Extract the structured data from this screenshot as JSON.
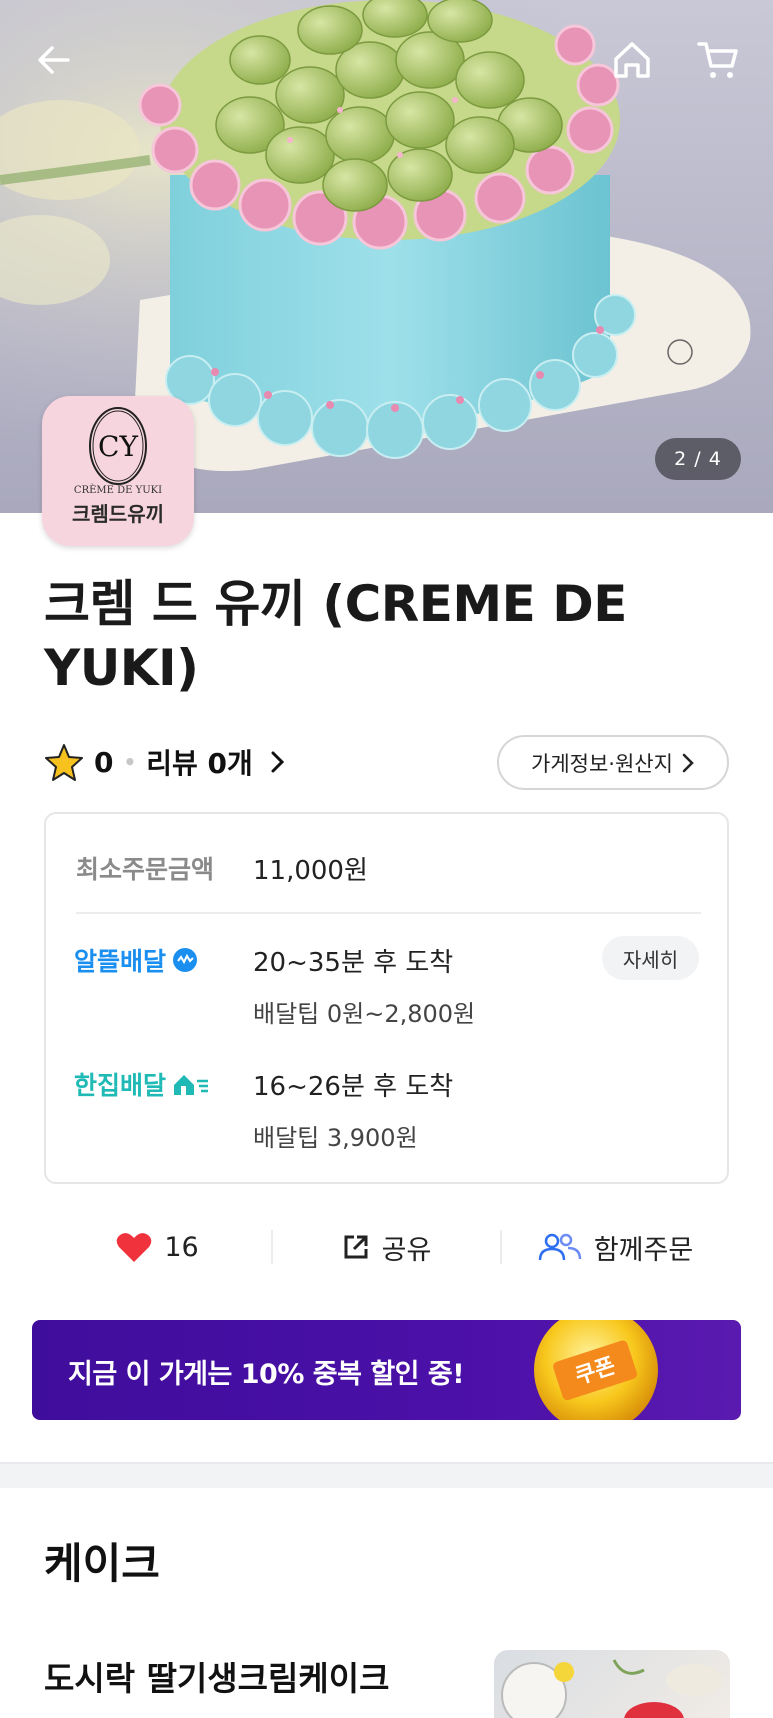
{
  "hero": {
    "page_indicator": "2 / 4",
    "icons": {
      "back": "arrow-left-icon",
      "home": "home-icon",
      "cart": "cart-icon"
    }
  },
  "logo": {
    "monogram": "CY",
    "brand_text": "CRÈME DE YUKI",
    "caption": "크렘드유끼"
  },
  "store": {
    "title": "크렘 드 유끼 (CREME DE YUKI)",
    "rating": "0",
    "review_label": "리뷰 0개",
    "info_button": "가게정보·원산지"
  },
  "info": {
    "min_order_label": "최소주문금액",
    "min_order_value": "11,000원",
    "deliveries": [
      {
        "brand": "알뜰배달",
        "time": "20~35분 후 도착",
        "tip": "배달팁 0원~2,800원",
        "color": "#1b8ff0"
      },
      {
        "brand": "한집배달",
        "time": "16~26분 후 도착",
        "tip": "배달팁 3,900원",
        "color": "#1fbab5"
      }
    ],
    "detail_button": "자세히"
  },
  "actions": {
    "like_count": "16",
    "share_label": "공유",
    "group_order_label": "함께주문"
  },
  "banner": {
    "text": "지금 이 가게는 10% 중복 할인 중!",
    "coupon_label": "쿠폰",
    "bg_color": "#4b10a8"
  },
  "menu": {
    "section_title": "케이크",
    "items": [
      {
        "name": "도시락 딸기생크림케이크"
      }
    ]
  }
}
